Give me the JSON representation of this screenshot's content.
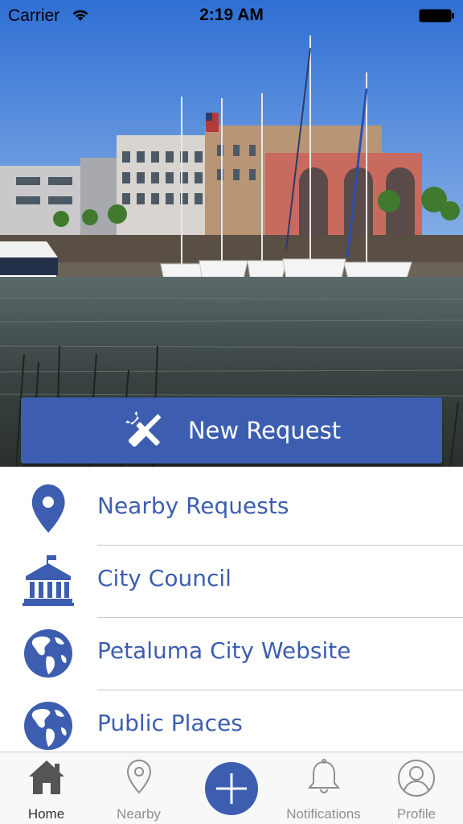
{
  "status_bar": {
    "carrier": "Carrier",
    "time": "2:19 AM"
  },
  "hero": {
    "image": "harbor-photo"
  },
  "new_request": {
    "label": "New Request",
    "icon": "tools-icon"
  },
  "menu": {
    "items": [
      {
        "label": "Nearby Requests",
        "icon": "location-pin-icon"
      },
      {
        "label": "City Council",
        "icon": "city-hall-icon"
      },
      {
        "label": "Petaluma City Website",
        "icon": "globe-icon"
      },
      {
        "label": "Public Places",
        "icon": "globe-icon"
      }
    ]
  },
  "tab_bar": {
    "tabs": [
      {
        "label": "Home",
        "icon": "home-icon",
        "active": true
      },
      {
        "label": "Nearby",
        "icon": "location-pin-outline-icon"
      },
      {
        "label": "",
        "icon": "add-icon"
      },
      {
        "label": "Notifications",
        "icon": "bell-icon"
      },
      {
        "label": "Profile",
        "icon": "profile-icon"
      }
    ]
  },
  "colors": {
    "accent": "#3d5eb0",
    "tab_inactive": "#8e8e93",
    "divider": "#c8c8cc"
  }
}
